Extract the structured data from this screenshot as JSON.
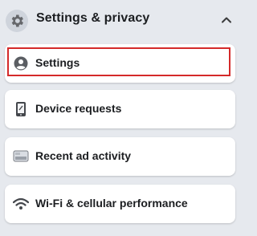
{
  "section": {
    "title": "Settings & privacy",
    "icon": "gear-icon",
    "expanded": true
  },
  "items": [
    {
      "label": "Settings",
      "icon": "person-circle-icon",
      "highlighted": true
    },
    {
      "label": "Device requests",
      "icon": "phone-icon",
      "highlighted": false
    },
    {
      "label": "Recent ad activity",
      "icon": "ad-activity-icon",
      "highlighted": false
    },
    {
      "label": "Wi-Fi & cellular performance",
      "icon": "wifi-icon",
      "highlighted": false
    }
  ],
  "colors": {
    "background": "#e6e9ee",
    "card": "#ffffff",
    "highlight_border": "#d42a2a",
    "text": "#1c1e21"
  }
}
